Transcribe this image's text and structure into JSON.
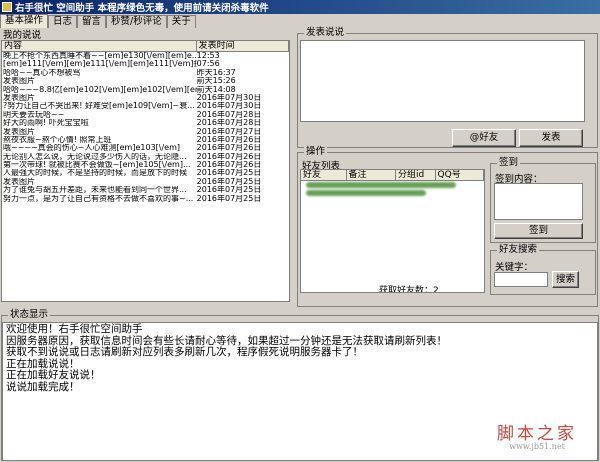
{
  "window": {
    "title": "右手很忙 空间助手 本程序绿色无毒，使用前请关闭杀毒软件"
  },
  "tabs": [
    {
      "label": "基本操作",
      "active": true
    },
    {
      "label": "日志",
      "active": false
    },
    {
      "label": "留言",
      "active": false
    },
    {
      "label": "秒赞/秒评论",
      "active": false
    },
    {
      "label": "关于",
      "active": false
    }
  ],
  "my_posts": {
    "group_title": "我的说说",
    "columns": [
      "内容",
      "发表时间"
    ],
    "rows": [
      {
        "content": "晚上不抢个东西真睡不着~~[em]e130[\\/em][em]e...",
        "time": "12:53"
      },
      {
        "content": "[em]e111[\\/em][em]e111[\\/em][em]e111[\\/em]拉了...",
        "time": "07:56"
      },
      {
        "content": "哈哈~~真心不想被骂",
        "time": "昨天16:37"
      },
      {
        "content": "发表图片",
        "time": "前天15:26"
      },
      {
        "content": "哈哈~~~8.8亿[em]e102[\\/em][em]e102[\\/em][em]...",
        "time": "前天14:08"
      },
      {
        "content": "发表图片",
        "time": "2016年07月30日"
      },
      {
        "content": "?努力让自己不哭出来! 好难受[em]e109[\\/em]~衰...",
        "time": "2016年07月30日"
      },
      {
        "content": "明天要去玩哈~~",
        "time": "2016年07月28日"
      },
      {
        "content": "好大的雨啊! 吓死宝宝啦",
        "time": "2016年07月28日"
      },
      {
        "content": "发表图片",
        "time": "2016年07月27日"
      },
      {
        "content": "熬夜衣服~熬个心情! 照常上班",
        "time": "2016年07月26日"
      },
      {
        "content": "哦~~~~真会的伤心~人心难测[em]e103[\\/em]",
        "time": "2016年07月26日"
      },
      {
        "content": "无论别人怎么说，无论说过多少伤人的话，无论隐...",
        "time": "2016年07月26日"
      },
      {
        "content": "第一次带球! 就被比赛不会做饭~[em]e105[\\/em]...",
        "time": "2016年07月26日"
      },
      {
        "content": "人最强大的时候，不是坚持的时候，而是放下的时候",
        "time": "2016年07月25日"
      },
      {
        "content": "发表图片",
        "time": "2016年07月25日"
      },
      {
        "content": "为了谁兔与胡五开差距，未来也能看到同一个世界...",
        "time": "2016年07月25日"
      },
      {
        "content": "努力一点，是为了让自己有资格不去做不喜欢的事~...",
        "time": "2016年07月25日"
      }
    ]
  },
  "compose": {
    "group_title": "发表说说",
    "at_friend_label": "@好友",
    "publish_label": "发表"
  },
  "operations": {
    "group_title": "操作",
    "friend_list": {
      "title": "好友列表",
      "columns": [
        "好友",
        "备注",
        "分组id",
        "QQ号"
      ],
      "status": "获取好友数：2"
    },
    "sign": {
      "title": "签到",
      "content_label": "签到内容：",
      "button_label": "签到"
    },
    "search": {
      "title": "好友搜索",
      "keyword_label": "关键字：",
      "button_label": "搜索"
    }
  },
  "status_display": {
    "title": "状态显示",
    "lines": [
      "欢迎使用！右手很忙空间助手",
      "因服务器原因，获取信息时间会有些长请耐心等待，如果超过一分钟还是无法获取请刷新列表！",
      "获取不到说说或日志请刷新对应列表多刷新几次，程序假死说明服务器卡了！",
      "正在加载说说！",
      "正在加载好友说说！",
      "说说加载完成！"
    ]
  },
  "watermark": {
    "brand": "脚本之家",
    "url": "www.jb51.net"
  }
}
